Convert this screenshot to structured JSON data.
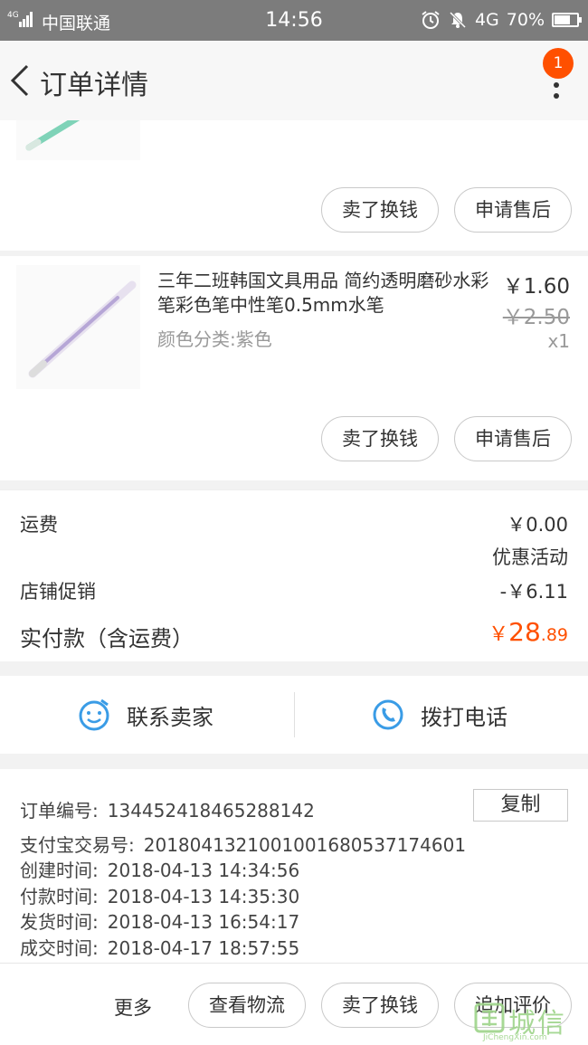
{
  "status_bar": {
    "network": "4G",
    "carrier": "中国联通",
    "time": "14:56",
    "data": "4G",
    "battery": "70%",
    "battery_level": 0.7
  },
  "nav": {
    "title": "订单详情",
    "badge": "1"
  },
  "item1": {
    "buttons": [
      "卖了换钱",
      "申请售后"
    ]
  },
  "item2": {
    "title": "三年二班韩国文具用品 简约透明磨砂水彩笔彩色笔中性笔0.5mm水笔",
    "variant": "颜色分类:紫色",
    "price": "￥1.60",
    "original_price": "￥2.50",
    "quantity": "x1",
    "buttons": [
      "卖了换钱",
      "申请售后"
    ]
  },
  "summary": {
    "shipping_label": "运费",
    "shipping_value": "￥0.00",
    "promo_heading": "优惠活动",
    "store_promo_label": "店铺促销",
    "store_promo_value": "-￥6.11",
    "total_label": "实付款（含运费）",
    "total_currency": "￥",
    "total_integer": "28",
    "total_decimal": ".89"
  },
  "contact": {
    "seller_label": "联系卖家",
    "phone_label": "拨打电话"
  },
  "order_info": {
    "order_no_label": "订单编号:",
    "order_no": "134452418465288142",
    "copy_label": "复制",
    "alipay_label": "支付宝交易号:",
    "alipay_no": "2018041321001001680537174601",
    "created_label": "创建时间:",
    "created": "2018-04-13 14:34:56",
    "paid_label": "付款时间:",
    "paid": "2018-04-13 14:35:30",
    "shipped_label": "发货时间:",
    "shipped": "2018-04-13 16:54:17",
    "completed_label": "成交时间:",
    "completed": "2018-04-17 18:57:55"
  },
  "bottom_bar": {
    "more_label": "更多",
    "logistics_label": "查看物流",
    "resell_label": "卖了换钱",
    "review_label": "追加评价"
  },
  "watermark": {
    "text": "城信",
    "site": "JiChengXin.com"
  }
}
